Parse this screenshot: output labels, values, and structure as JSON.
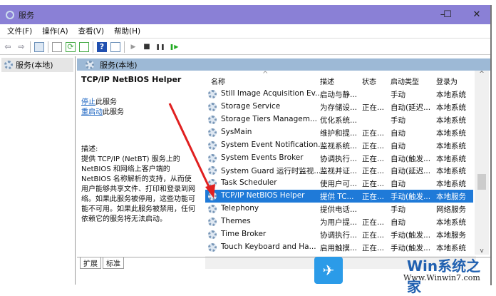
{
  "window": {
    "title": "服务",
    "controls": {
      "minimize": "–",
      "maximize": "☐",
      "close": "✕"
    }
  },
  "menu": [
    "文件(F)",
    "操作(A)",
    "查看(V)",
    "帮助(H)"
  ],
  "toolbar": {
    "back": "⇦",
    "forward": "⇨",
    "play": "▶",
    "stop": "■",
    "pause": "❚❚",
    "resume": "❚▶"
  },
  "tree": {
    "root": "服务(本地)"
  },
  "pane": {
    "header": "服务(本地)"
  },
  "detail": {
    "title": "TCP/IP NetBIOS Helper",
    "stop_link": "停止",
    "stop_suffix": "此服务",
    "restart_link": "重启动",
    "restart_suffix": "此服务",
    "desc_label": "描述:",
    "desc": "提供 TCP/IP (NetBT) 服务上的 NetBIOS 和网络上客户端的 NetBIOS 名称解析的支持，从而使用户能够共享文件、打印和登录到网络。如果此服务被停用，这些功能可能不可用。如果此服务被禁用，任何依赖它的服务将无法启动。"
  },
  "columns": [
    "名称",
    "描述",
    "状态",
    "启动类型",
    "登录为"
  ],
  "rows": [
    {
      "name": "Still Image Acquisition Ev...",
      "desc": "启动与静...",
      "status": "",
      "startup": "手动",
      "logon": "本地系统"
    },
    {
      "name": "Storage Service",
      "desc": "为存储设...",
      "status": "正在...",
      "startup": "自动(延迟...",
      "logon": "本地系统"
    },
    {
      "name": "Storage Tiers Managem...",
      "desc": "优化系统...",
      "status": "",
      "startup": "手动",
      "logon": "本地系统"
    },
    {
      "name": "SysMain",
      "desc": "维护和提...",
      "status": "正在...",
      "startup": "自动",
      "logon": "本地系统"
    },
    {
      "name": "System Event Notification...",
      "desc": "监视系统...",
      "status": "正在...",
      "startup": "自动",
      "logon": "本地系统"
    },
    {
      "name": "System Events Broker",
      "desc": "协调执行...",
      "status": "正在...",
      "startup": "自动(触发...",
      "logon": "本地系统"
    },
    {
      "name": "System Guard 运行时监视...",
      "desc": "监视并证...",
      "status": "正在...",
      "startup": "自动(延迟...",
      "logon": "本地系统"
    },
    {
      "name": "Task Scheduler",
      "desc": "使用户可...",
      "status": "正在...",
      "startup": "自动",
      "logon": "本地系统"
    },
    {
      "name": "TCP/IP NetBIOS Helper",
      "desc": "提供 TC...",
      "status": "正在...",
      "startup": "手动(触发...",
      "logon": "本地服务"
    },
    {
      "name": "Telephony",
      "desc": "提供电话...",
      "status": "",
      "startup": "手动",
      "logon": "网络服务"
    },
    {
      "name": "Themes",
      "desc": "为用户提...",
      "status": "正在...",
      "startup": "自动",
      "logon": "本地系统"
    },
    {
      "name": "Time Broker",
      "desc": "协调执行...",
      "status": "正在...",
      "startup": "手动(触发...",
      "logon": "本地服务"
    },
    {
      "name": "Touch Keyboard and Ha...",
      "desc": "启用触摸...",
      "status": "正在...",
      "startup": "手动(触发...",
      "logon": "本地系统"
    }
  ],
  "selected_index": 8,
  "tabs": [
    "扩展",
    "标准"
  ],
  "watermark": {
    "brand": "Win系统之家",
    "url": "Www.Winwin7.com"
  },
  "colors": {
    "titlebar": "#8a80d6",
    "selection": "#1f7ad8",
    "arrow": "#e02020"
  }
}
